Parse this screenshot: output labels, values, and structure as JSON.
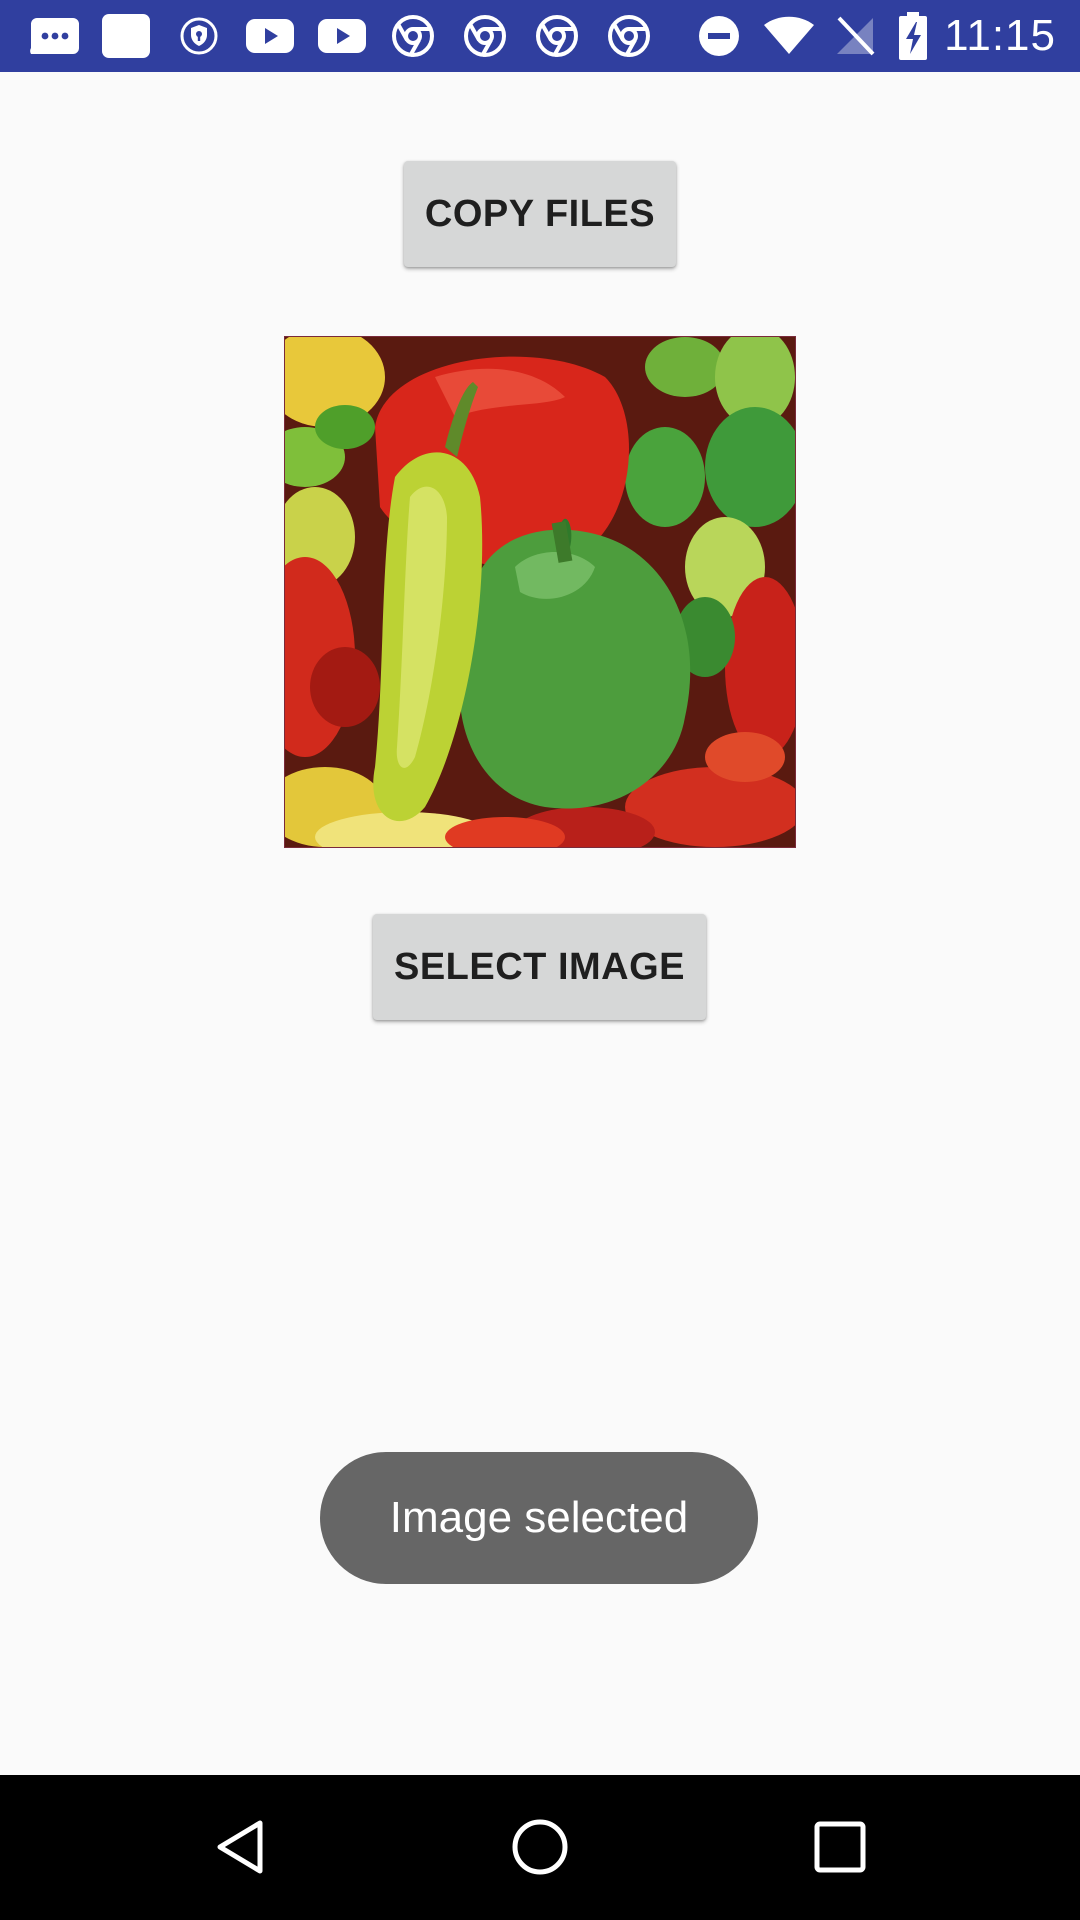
{
  "status_bar": {
    "time": "11:15",
    "background": "#303f9f",
    "left_icons": [
      "message-icon",
      "square-notification-icon",
      "vpn-shield-icon",
      "youtube-icon",
      "youtube-icon",
      "chrome-icon",
      "chrome-icon",
      "chrome-icon",
      "chrome-icon"
    ],
    "right_icons": [
      "do-not-disturb-icon",
      "wifi-icon",
      "no-signal-icon",
      "battery-charging-icon"
    ]
  },
  "main": {
    "copy_button_label": "COPY FILES",
    "select_button_label": "SELECT IMAGE",
    "button_color": "#d6d7d7"
  },
  "toast": {
    "message": "Image selected",
    "background": "#666666"
  },
  "nav_bar": {
    "buttons": [
      "back-icon",
      "home-icon",
      "recents-icon"
    ]
  }
}
